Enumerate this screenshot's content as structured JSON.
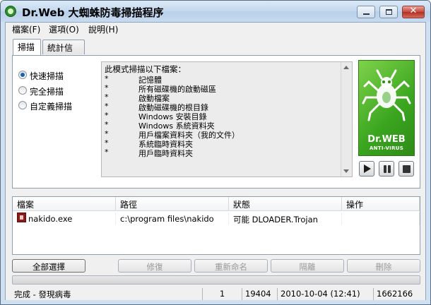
{
  "window": {
    "title": "Dr.Web 大蜘蛛防毒掃描程序"
  },
  "menu": [
    "檔案(F)",
    "選項(O)",
    "說明(H)"
  ],
  "tabs": [
    {
      "label": "掃描",
      "active": true
    },
    {
      "label": "統計信息",
      "active": false
    }
  ],
  "scan_modes": [
    {
      "label": "快速掃描",
      "checked": true
    },
    {
      "label": "完全掃描",
      "checked": false
    },
    {
      "label": "自定義掃描",
      "checked": false
    }
  ],
  "description": {
    "heading": "此模式掃描以下檔案：",
    "bullet": "*",
    "items": [
      "記憶體",
      "所有磁碟機的啟動磁區",
      "啟動檔案",
      "啟動磁碟機的根目錄",
      "Windows 安裝目錄",
      "Windows 系統資料夾",
      "用戶檔案資料夾（我的文件）",
      "系統臨時資料夾",
      "用戶臨時資料夾"
    ]
  },
  "logo": {
    "brand": "Dr.WEB",
    "sub": "ANTI-VIRUS",
    "color": "#3aa51f"
  },
  "controls": [
    {
      "name": "start",
      "icon": "play-icon"
    },
    {
      "name": "pause",
      "icon": "pause-icon"
    },
    {
      "name": "stop",
      "icon": "stop-icon"
    }
  ],
  "results": {
    "columns": [
      "檔案",
      "路徑",
      "狀態",
      "操作"
    ],
    "rows": [
      {
        "file": "nakido.exe",
        "path": "c:\\program files\\nakido",
        "status": "可能 DLOADER.Trojan",
        "action": "",
        "icon": "infected-file-icon"
      }
    ]
  },
  "actions": [
    {
      "label": "全部選擇",
      "enabled": true
    },
    {
      "label": "修復",
      "enabled": false
    },
    {
      "label": "重新命名",
      "enabled": false
    },
    {
      "label": "隔離",
      "enabled": false
    },
    {
      "label": "刪除",
      "enabled": false
    }
  ],
  "status": {
    "message": "完成 - 發現病毒",
    "infected": "1",
    "scanned": "19404",
    "date": "2010-10-04 (12:41)",
    "db_records": "1662166"
  }
}
